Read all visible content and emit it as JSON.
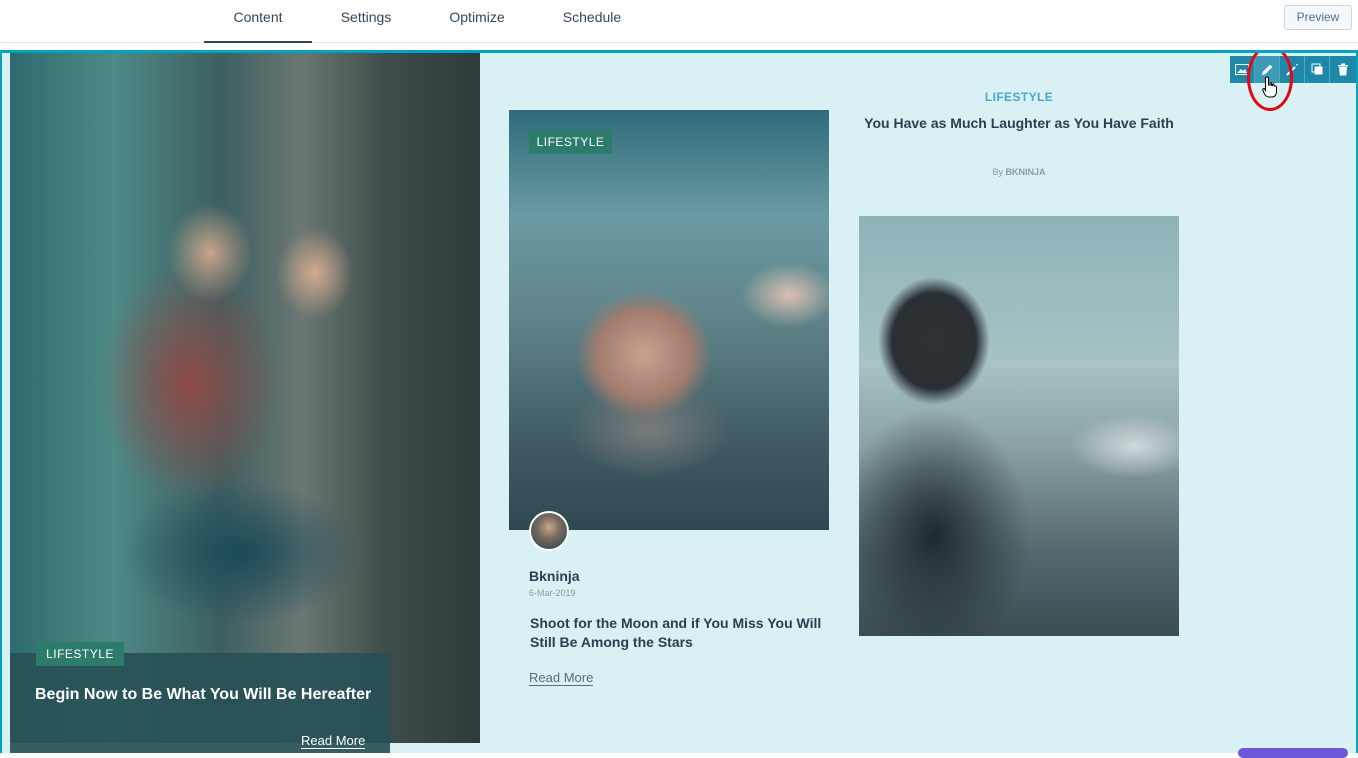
{
  "tabs": [
    {
      "label": "Content",
      "active": true
    },
    {
      "label": "Settings",
      "active": false
    },
    {
      "label": "Optimize",
      "active": false
    },
    {
      "label": "Schedule",
      "active": false
    }
  ],
  "preview_label": "Preview",
  "feature": {
    "category": "LIFESTYLE",
    "title": "Begin Now to Be What You Will Be Hereafter",
    "read_more": "Read More"
  },
  "middle_card": {
    "category": "LIFESTYLE",
    "author": "Bkninja",
    "date": "6-Mar-2019",
    "title": "Shoot for the Moon and if You Miss You Will Still Be Among the Stars",
    "read_more": "Read More"
  },
  "right_card": {
    "category": "LIFESTYLE",
    "title": "You Have as Much Laughter as You Have Faith",
    "by_prefix": "By",
    "author": "BKNINJA"
  },
  "module_toolbar": {
    "icons": [
      "image-icon",
      "pencil-icon",
      "magic-icon",
      "clone-icon",
      "trash-icon"
    ],
    "accent": "#1e88a8"
  },
  "colors": {
    "canvas_bg": "#d9f1f4",
    "selection_border": "#00a4bd",
    "badge": "#2d7c6b",
    "highlight_ring": "#e10914"
  }
}
